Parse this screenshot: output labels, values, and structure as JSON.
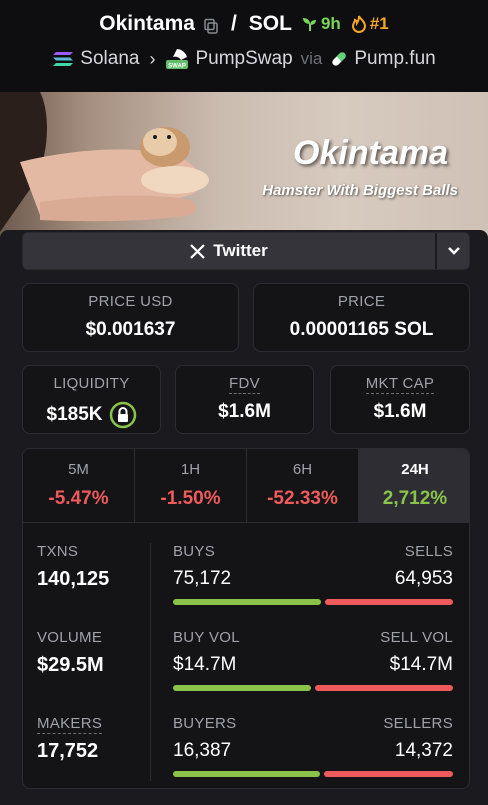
{
  "header": {
    "token_name": "Okintama",
    "quote": "SOL",
    "age": "9h",
    "rank": "#1",
    "chain": "Solana",
    "dex": "PumpSwap",
    "via_label": "via",
    "launchpad": "Pump.fun",
    "dex_badge": "SWAP"
  },
  "banner": {
    "title": "Okintama",
    "subtitle": "Hamster With Biggest Balls"
  },
  "social": {
    "twitter_label": "Twitter"
  },
  "price": {
    "usd_label": "PRICE USD",
    "usd_value": "$0.001637",
    "native_label": "PRICE",
    "native_value": "0.00001165 SOL"
  },
  "metrics": {
    "liquidity_label": "LIQUIDITY",
    "liquidity_value": "$185K",
    "fdv_label": "FDV",
    "fdv_value": "$1.6M",
    "mcap_label": "MKT CAP",
    "mcap_value": "$1.6M"
  },
  "tabs": [
    {
      "label": "5M",
      "value": "-5.47%"
    },
    {
      "label": "1H",
      "value": "-1.50%"
    },
    {
      "label": "6H",
      "value": "-52.33%"
    },
    {
      "label": "24H",
      "value": "2,712%"
    }
  ],
  "stats": {
    "txns_label": "TXNS",
    "txns_value": "140,125",
    "volume_label": "VOLUME",
    "volume_value": "$29.5M",
    "makers_label": "MAKERS",
    "makers_value": "17,752",
    "buys_label": "BUYS",
    "buys_value": "75,172",
    "sells_label": "SELLS",
    "sells_value": "64,953",
    "buy_vol_label": "BUY VOL",
    "buy_vol_value": "$14.7M",
    "sell_vol_label": "SELL VOL",
    "sell_vol_value": "$14.7M",
    "buyers_label": "BUYERS",
    "buyers_value": "16,387",
    "sellers_label": "SELLERS",
    "sellers_value": "14,372"
  },
  "ratios": {
    "txns_buy_share": 0.536,
    "vol_buy_share": 0.5,
    "makers_buy_share": 0.533
  },
  "colors": {
    "positive": "#8bc34a",
    "negative": "#ef5b5b",
    "age_green": "#79d55b",
    "rank_orange": "#f6a623"
  }
}
